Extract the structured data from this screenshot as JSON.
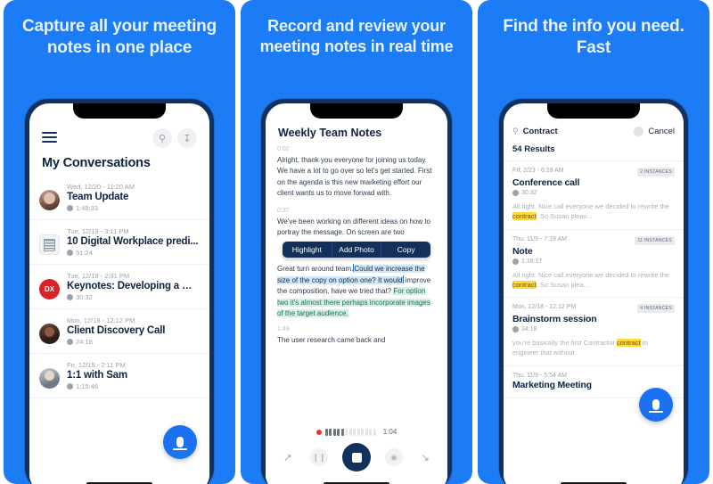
{
  "panels": [
    {
      "headline": "Capture all your meeting notes in one place",
      "screen": {
        "menu_icon": "hamburger-icon",
        "search_icon": "search-icon",
        "save_icon": "save-icon",
        "title": "My Conversations",
        "conversations": [
          {
            "date": "Wed, 12/20 - 11:20 AM",
            "name": "Team Update",
            "duration": "1:48:33",
            "avatar": "photo-woman"
          },
          {
            "date": "Tue, 12/19 - 3:11 PM",
            "name": "10 Digital Workplace predi...",
            "duration": "51:24",
            "avatar": "document"
          },
          {
            "date": "Tue, 12/19 - 2:31 PM",
            "name": "Keynotes: Developing a Cu...",
            "duration": "30:32",
            "avatar": "dx-logo",
            "avatar_text": "DX"
          },
          {
            "date": "Mon, 12/18 - 12:12 PM",
            "name": "Client Discovery Call",
            "duration": "24:18",
            "avatar": "photo-person"
          },
          {
            "date": "Fri, 12/15 - 2:11 PM",
            "name": "1:1 with Sam",
            "duration": "1:15:46",
            "avatar": "photo-man"
          }
        ],
        "fab": "record-microphone-button"
      }
    },
    {
      "headline": "Record and review your meeting notes in real time",
      "screen": {
        "title": "Weekly Team Notes",
        "segments": [
          {
            "timestamp": "0:02",
            "text": "Alright, thank you everyone for joining us today. We have a lot to go over so let's get started. First on the agenda is this new marketing effort our client wants us to move forwad with."
          },
          {
            "timestamp": "0:37",
            "text": "We've been working on different ideas on how to portray the message. On screen are two"
          }
        ],
        "context_menu": [
          "Highlight",
          "Add Photo",
          "Copy"
        ],
        "selection": {
          "plain_before": "Great turn around team.",
          "selected": "Could we increase the size of the copy on option one? It would",
          "plain_middle": "improve the composition, have we tried that?",
          "highlighted": "For option two it's almost there perhaps incorporate images of the target audience."
        },
        "last_segment": {
          "timestamp": "1:49",
          "text": "The user research came back and"
        },
        "recorder": {
          "time": "1:04",
          "record_dot": "record-indicator",
          "share_icon": "share-icon",
          "pause_icon": "pause-icon",
          "stop_icon": "stop-button",
          "camera_icon": "camera-icon",
          "tag_icon": "tag-speaker-icon"
        }
      }
    },
    {
      "headline": "Find the info you need. Fast",
      "screen": {
        "search_icon": "search-icon",
        "search_value": "Contract",
        "clear_icon": "clear-icon",
        "cancel_label": "Cancel",
        "results_count": "54 Results",
        "results": [
          {
            "date": "Fri, 2/23 - 6:28 AM",
            "badge": "2 INSTANCES",
            "title": "Conference call",
            "duration": "30:32",
            "snippet_before": "All right. Nice call everyone we decided to rewrite the ",
            "snippet_match": "contract",
            "snippet_after": ". So Susan pleas..."
          },
          {
            "date": "Thu, 11/9 - 7:19 AM",
            "badge": "11 INSTANCES",
            "title": "Note",
            "duration": "1:16:17",
            "snippet_before": "All right. Nice call everyone we decided to rewrite the ",
            "snippet_match": "contract",
            "snippet_after": ". So Susan plea..."
          },
          {
            "date": "Mon, 12/18 - 12:12 PM",
            "badge": "4 INSTANCES",
            "title": "Brainstorm session",
            "duration": "34:18",
            "snippet_before": "you're basically the first Contractor ",
            "snippet_match": "contract",
            "snippet_after": " to engineer that without"
          },
          {
            "date": "Thu, 11/9 - 5:54 AM",
            "badge": "",
            "title": "Marketing Meeting",
            "duration": "",
            "snippet_before": "",
            "snippet_match": "",
            "snippet_after": ""
          }
        ],
        "fab": "record-microphone-button"
      }
    }
  ],
  "colors": {
    "brand_blue": "#1b7cf5",
    "fab_blue": "#1b72f0",
    "navy": "#12315e",
    "highlight_yellow": "#ffd83d",
    "selection_blue": "#cfe7fb",
    "highlight_green": "#d5f0e4",
    "record_red": "#e8342a"
  }
}
